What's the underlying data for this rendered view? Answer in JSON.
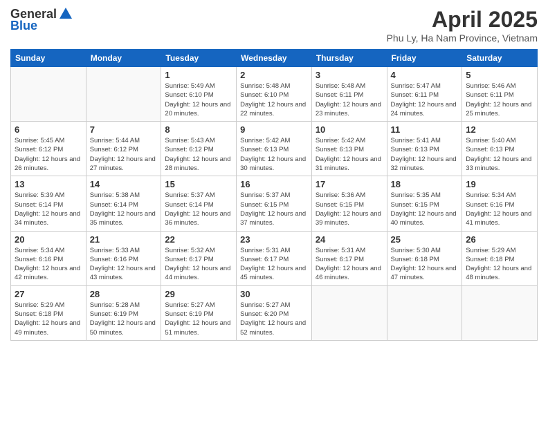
{
  "logo": {
    "line1": "General",
    "line2": "Blue"
  },
  "title": "April 2025",
  "subtitle": "Phu Ly, Ha Nam Province, Vietnam",
  "days_of_week": [
    "Sunday",
    "Monday",
    "Tuesday",
    "Wednesday",
    "Thursday",
    "Friday",
    "Saturday"
  ],
  "weeks": [
    [
      {
        "day": "",
        "sunrise": "",
        "sunset": "",
        "daylight": ""
      },
      {
        "day": "",
        "sunrise": "",
        "sunset": "",
        "daylight": ""
      },
      {
        "day": "1",
        "sunrise": "Sunrise: 5:49 AM",
        "sunset": "Sunset: 6:10 PM",
        "daylight": "Daylight: 12 hours and 20 minutes."
      },
      {
        "day": "2",
        "sunrise": "Sunrise: 5:48 AM",
        "sunset": "Sunset: 6:10 PM",
        "daylight": "Daylight: 12 hours and 22 minutes."
      },
      {
        "day": "3",
        "sunrise": "Sunrise: 5:48 AM",
        "sunset": "Sunset: 6:11 PM",
        "daylight": "Daylight: 12 hours and 23 minutes."
      },
      {
        "day": "4",
        "sunrise": "Sunrise: 5:47 AM",
        "sunset": "Sunset: 6:11 PM",
        "daylight": "Daylight: 12 hours and 24 minutes."
      },
      {
        "day": "5",
        "sunrise": "Sunrise: 5:46 AM",
        "sunset": "Sunset: 6:11 PM",
        "daylight": "Daylight: 12 hours and 25 minutes."
      }
    ],
    [
      {
        "day": "6",
        "sunrise": "Sunrise: 5:45 AM",
        "sunset": "Sunset: 6:12 PM",
        "daylight": "Daylight: 12 hours and 26 minutes."
      },
      {
        "day": "7",
        "sunrise": "Sunrise: 5:44 AM",
        "sunset": "Sunset: 6:12 PM",
        "daylight": "Daylight: 12 hours and 27 minutes."
      },
      {
        "day": "8",
        "sunrise": "Sunrise: 5:43 AM",
        "sunset": "Sunset: 6:12 PM",
        "daylight": "Daylight: 12 hours and 28 minutes."
      },
      {
        "day": "9",
        "sunrise": "Sunrise: 5:42 AM",
        "sunset": "Sunset: 6:13 PM",
        "daylight": "Daylight: 12 hours and 30 minutes."
      },
      {
        "day": "10",
        "sunrise": "Sunrise: 5:42 AM",
        "sunset": "Sunset: 6:13 PM",
        "daylight": "Daylight: 12 hours and 31 minutes."
      },
      {
        "day": "11",
        "sunrise": "Sunrise: 5:41 AM",
        "sunset": "Sunset: 6:13 PM",
        "daylight": "Daylight: 12 hours and 32 minutes."
      },
      {
        "day": "12",
        "sunrise": "Sunrise: 5:40 AM",
        "sunset": "Sunset: 6:13 PM",
        "daylight": "Daylight: 12 hours and 33 minutes."
      }
    ],
    [
      {
        "day": "13",
        "sunrise": "Sunrise: 5:39 AM",
        "sunset": "Sunset: 6:14 PM",
        "daylight": "Daylight: 12 hours and 34 minutes."
      },
      {
        "day": "14",
        "sunrise": "Sunrise: 5:38 AM",
        "sunset": "Sunset: 6:14 PM",
        "daylight": "Daylight: 12 hours and 35 minutes."
      },
      {
        "day": "15",
        "sunrise": "Sunrise: 5:37 AM",
        "sunset": "Sunset: 6:14 PM",
        "daylight": "Daylight: 12 hours and 36 minutes."
      },
      {
        "day": "16",
        "sunrise": "Sunrise: 5:37 AM",
        "sunset": "Sunset: 6:15 PM",
        "daylight": "Daylight: 12 hours and 37 minutes."
      },
      {
        "day": "17",
        "sunrise": "Sunrise: 5:36 AM",
        "sunset": "Sunset: 6:15 PM",
        "daylight": "Daylight: 12 hours and 39 minutes."
      },
      {
        "day": "18",
        "sunrise": "Sunrise: 5:35 AM",
        "sunset": "Sunset: 6:15 PM",
        "daylight": "Daylight: 12 hours and 40 minutes."
      },
      {
        "day": "19",
        "sunrise": "Sunrise: 5:34 AM",
        "sunset": "Sunset: 6:16 PM",
        "daylight": "Daylight: 12 hours and 41 minutes."
      }
    ],
    [
      {
        "day": "20",
        "sunrise": "Sunrise: 5:34 AM",
        "sunset": "Sunset: 6:16 PM",
        "daylight": "Daylight: 12 hours and 42 minutes."
      },
      {
        "day": "21",
        "sunrise": "Sunrise: 5:33 AM",
        "sunset": "Sunset: 6:16 PM",
        "daylight": "Daylight: 12 hours and 43 minutes."
      },
      {
        "day": "22",
        "sunrise": "Sunrise: 5:32 AM",
        "sunset": "Sunset: 6:17 PM",
        "daylight": "Daylight: 12 hours and 44 minutes."
      },
      {
        "day": "23",
        "sunrise": "Sunrise: 5:31 AM",
        "sunset": "Sunset: 6:17 PM",
        "daylight": "Daylight: 12 hours and 45 minutes."
      },
      {
        "day": "24",
        "sunrise": "Sunrise: 5:31 AM",
        "sunset": "Sunset: 6:17 PM",
        "daylight": "Daylight: 12 hours and 46 minutes."
      },
      {
        "day": "25",
        "sunrise": "Sunrise: 5:30 AM",
        "sunset": "Sunset: 6:18 PM",
        "daylight": "Daylight: 12 hours and 47 minutes."
      },
      {
        "day": "26",
        "sunrise": "Sunrise: 5:29 AM",
        "sunset": "Sunset: 6:18 PM",
        "daylight": "Daylight: 12 hours and 48 minutes."
      }
    ],
    [
      {
        "day": "27",
        "sunrise": "Sunrise: 5:29 AM",
        "sunset": "Sunset: 6:18 PM",
        "daylight": "Daylight: 12 hours and 49 minutes."
      },
      {
        "day": "28",
        "sunrise": "Sunrise: 5:28 AM",
        "sunset": "Sunset: 6:19 PM",
        "daylight": "Daylight: 12 hours and 50 minutes."
      },
      {
        "day": "29",
        "sunrise": "Sunrise: 5:27 AM",
        "sunset": "Sunset: 6:19 PM",
        "daylight": "Daylight: 12 hours and 51 minutes."
      },
      {
        "day": "30",
        "sunrise": "Sunrise: 5:27 AM",
        "sunset": "Sunset: 6:20 PM",
        "daylight": "Daylight: 12 hours and 52 minutes."
      },
      {
        "day": "",
        "sunrise": "",
        "sunset": "",
        "daylight": ""
      },
      {
        "day": "",
        "sunrise": "",
        "sunset": "",
        "daylight": ""
      },
      {
        "day": "",
        "sunrise": "",
        "sunset": "",
        "daylight": ""
      }
    ]
  ]
}
